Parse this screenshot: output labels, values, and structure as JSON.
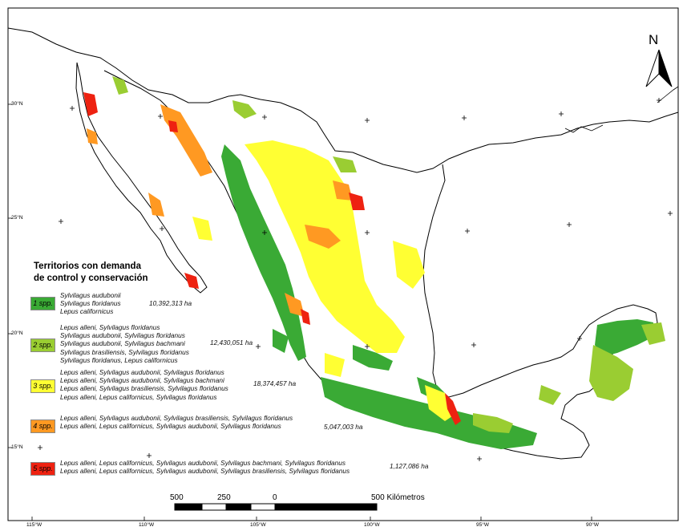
{
  "north_label": "N",
  "legend": {
    "title_line1": "Territorios con demanda",
    "title_line2": "de control y conservación",
    "classes": [
      {
        "label": "1 spp.",
        "color": "#3aaa35",
        "area": "10,392,313 ha",
        "species": [
          "Sylvilagus audubonii",
          "Sylvilagus floridanus",
          "Lepus californicus"
        ]
      },
      {
        "label": "2 spp.",
        "color": "#9acd32",
        "area": "12,430,051 ha",
        "species": [
          "Lepus alleni, Sylvilagus floridanus",
          "Sylvilagus audubonii, Sylvilagus floridanus",
          "Sylvilagus audubonii, Sylvilagus bachmani",
          "Sylvilagus brasiliensis, Sylvilagus floridanus",
          "Sylvilagus floridanus, Lepus californicus"
        ]
      },
      {
        "label": "3 spp.",
        "color": "#ffff33",
        "area": "18,374,457 ha",
        "species": [
          "Lepus alleni, Sylvilagus audubonii, Sylvilagus floridanus",
          "Lepus alleni, Sylvilagus audubonii, Sylvilagus bachmani",
          "Lepus alleni, Sylvilagus brasiliensis, Sylvilagus floridanus",
          "Lepus alleni, Lepus californicus, Sylvilagus floridanus"
        ]
      },
      {
        "label": "4 spp.",
        "color": "#ff9922",
        "area": "5,047,003 ha",
        "species": [
          "Lepus alleni, Sylvilagus audubonii, Sylvilagus brasiliensis, Sylvilagus floridanus",
          "Lepus alleni,   Lepus californicus, Sylvilagus audubonii, Sylvilagus floridanus"
        ]
      },
      {
        "label": "5 spp.",
        "color": "#ee2211",
        "area": "1,127,086 ha",
        "species": [
          "Lepus alleni,   Lepus californicus, Sylvilagus audubonii, Sylvilagus bachmani, Sylvilagus floridanus",
          "Lepus alleni,   Lepus californicus, Sylvilagus audubonii, Sylvilagus brasiliensis, Sylvilagus floridanus"
        ]
      }
    ]
  },
  "scale_bar": {
    "labels": [
      "500",
      "250",
      "0",
      "500 Kilómetros"
    ]
  },
  "lon_ticks": [
    "115°W",
    "110°W",
    "105°W",
    "100°W",
    "95°W",
    "90°W"
  ],
  "lat_ticks": [
    "30°N",
    "25°N",
    "20°N",
    "15°N"
  ]
}
